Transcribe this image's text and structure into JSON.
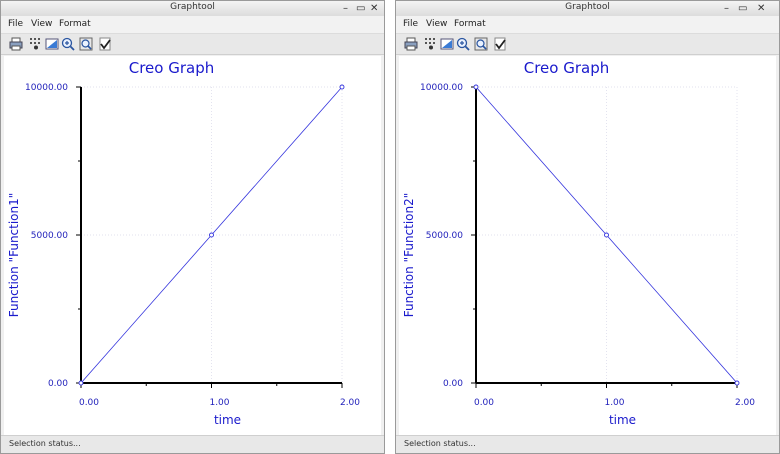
{
  "windows": [
    {
      "title": "Graphtool",
      "menu": {
        "file": "File",
        "view": "View",
        "format": "Format"
      },
      "status": "Selection status...",
      "chart_data": {
        "type": "line",
        "title": "Creo Graph",
        "xlabel": "time",
        "ylabel": "Function \"Function1\"",
        "x": [
          0,
          1,
          2
        ],
        "series": [
          {
            "values": [
              0,
              5000,
              10000
            ]
          }
        ],
        "xlim": [
          0,
          2
        ],
        "ylim": [
          0,
          10000
        ],
        "xticks": [
          "0.00",
          "1.00",
          "2.00"
        ],
        "yticks": [
          "0.00",
          "5000.00",
          "10000.00"
        ],
        "grid": true,
        "line_color": "#3333dd"
      }
    },
    {
      "title": "Graphtool",
      "menu": {
        "file": "File",
        "view": "View",
        "format": "Format"
      },
      "status": "Selection status...",
      "chart_data": {
        "type": "line",
        "title": "Creo Graph",
        "xlabel": "time",
        "ylabel": "Function \"Function2\"",
        "x": [
          0,
          1,
          2
        ],
        "series": [
          {
            "values": [
              10000,
              5000,
              0
            ]
          }
        ],
        "xlim": [
          0,
          2
        ],
        "ylim": [
          0,
          10000
        ],
        "xticks": [
          "0.00",
          "1.00",
          "2.00"
        ],
        "yticks": [
          "0.00",
          "5000.00",
          "10000.00"
        ],
        "grid": true,
        "line_color": "#3333dd"
      }
    }
  ]
}
